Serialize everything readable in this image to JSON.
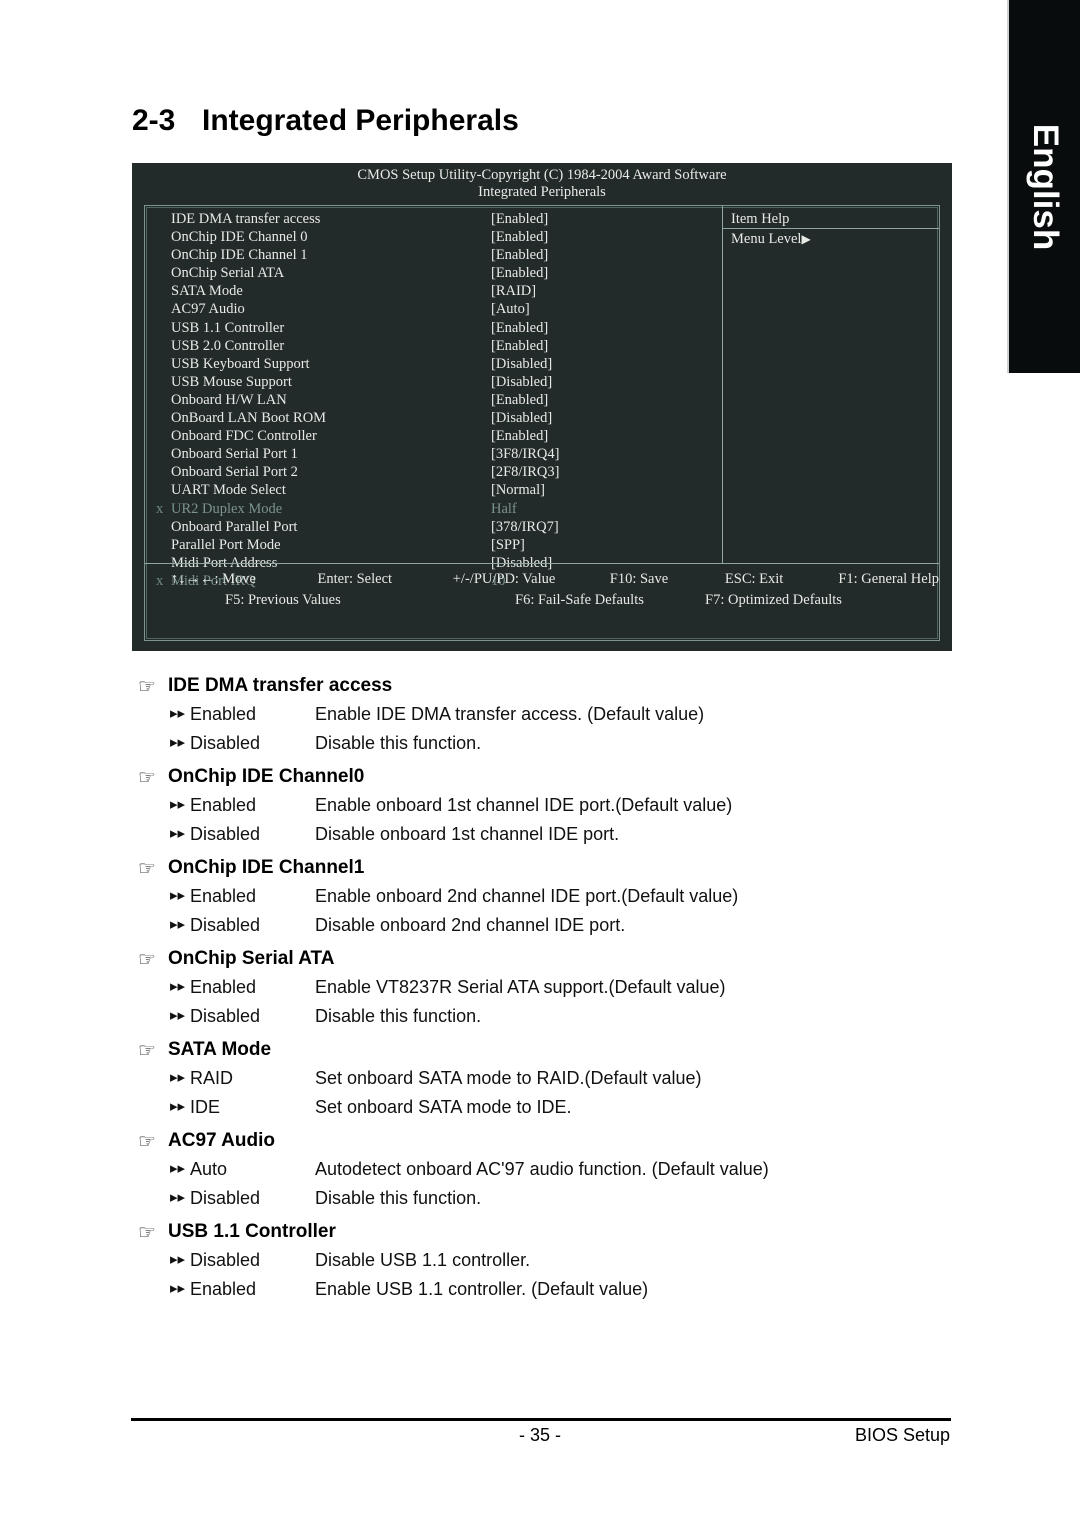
{
  "language_tab": {
    "label": "English"
  },
  "section": {
    "number": "2-3",
    "title": "Integrated Peripherals"
  },
  "bios": {
    "title_line1": "CMOS Setup Utility-Copyright (C) 1984-2004 Award Software",
    "title_line2": "Integrated Peripherals",
    "items": [
      {
        "marker": "",
        "label": "IDE DMA transfer access",
        "value": "[Enabled]",
        "dim": false
      },
      {
        "marker": "",
        "label": "OnChip IDE Channel 0",
        "value": "[Enabled]",
        "dim": false
      },
      {
        "marker": "",
        "label": "OnChip IDE Channel 1",
        "value": "[Enabled]",
        "dim": false
      },
      {
        "marker": "",
        "label": "OnChip Serial ATA",
        "value": "[Enabled]",
        "dim": false
      },
      {
        "marker": "",
        "label": "SATA Mode",
        "value": "[RAID]",
        "dim": false
      },
      {
        "marker": "",
        "label": "AC97 Audio",
        "value": "[Auto]",
        "dim": false
      },
      {
        "marker": "",
        "label": "USB 1.1 Controller",
        "value": "[Enabled]",
        "dim": false
      },
      {
        "marker": "",
        "label": "USB 2.0 Controller",
        "value": "[Enabled]",
        "dim": false
      },
      {
        "marker": "",
        "label": "USB Keyboard Support",
        "value": "[Disabled]",
        "dim": false
      },
      {
        "marker": "",
        "label": "USB Mouse Support",
        "value": "[Disabled]",
        "dim": false
      },
      {
        "marker": "",
        "label": "Onboard H/W LAN",
        "value": "[Enabled]",
        "dim": false
      },
      {
        "marker": "",
        "label": "OnBoard LAN Boot ROM",
        "value": "[Disabled]",
        "dim": false
      },
      {
        "marker": "",
        "label": "Onboard FDC Controller",
        "value": "[Enabled]",
        "dim": false
      },
      {
        "marker": "",
        "label": "Onboard Serial Port 1",
        "value": "[3F8/IRQ4]",
        "dim": false
      },
      {
        "marker": "",
        "label": "Onboard Serial Port 2",
        "value": "[2F8/IRQ3]",
        "dim": false
      },
      {
        "marker": "",
        "label": "UART Mode Select",
        "value": "[Normal]",
        "dim": false
      },
      {
        "marker": "x",
        "label": "UR2 Duplex Mode",
        "value": "Half",
        "dim": true
      },
      {
        "marker": "",
        "label": "Onboard Parallel Port",
        "value": "[378/IRQ7]",
        "dim": false
      },
      {
        "marker": "",
        "label": "Parallel Port Mode",
        "value": "[SPP]",
        "dim": false
      },
      {
        "marker": "",
        "label": "Midi Port Address",
        "value": "[Disabled]",
        "dim": false
      },
      {
        "marker": "x",
        "label": "Midi Port IRQ",
        "value": "10",
        "dim": true
      }
    ],
    "help": {
      "heading": "Item Help",
      "menu_level": "Menu Level",
      "menu_level_arrow": "▶"
    },
    "keys_row1": [
      "↑↓→←: Move",
      "Enter: Select",
      "+/-/PU/PD: Value",
      "F10: Save",
      "ESC: Exit",
      "F1: General Help"
    ],
    "keys_row2": [
      "F5: Previous Values",
      "F6: Fail-Safe Defaults",
      "F7: Optimized Defaults"
    ]
  },
  "options": [
    {
      "title": "IDE DMA transfer access",
      "rows": [
        {
          "name": "Enabled",
          "desc": "Enable IDE DMA transfer access. (Default value)"
        },
        {
          "name": "Disabled",
          "desc": "Disable this function."
        }
      ]
    },
    {
      "title": "OnChip IDE Channel0",
      "rows": [
        {
          "name": "Enabled",
          "desc": "Enable onboard 1st channel IDE port.(Default value)"
        },
        {
          "name": "Disabled",
          "desc": "Disable onboard 1st channel IDE port."
        }
      ]
    },
    {
      "title": "OnChip IDE Channel1",
      "rows": [
        {
          "name": "Enabled",
          "desc": "Enable onboard 2nd channel IDE port.(Default value)"
        },
        {
          "name": "Disabled",
          "desc": "Disable onboard 2nd channel IDE port."
        }
      ]
    },
    {
      "title": "OnChip Serial ATA",
      "rows": [
        {
          "name": "Enabled",
          "desc": "Enable VT8237R Serial ATA support.(Default value)"
        },
        {
          "name": "Disabled",
          "desc": "Disable this function."
        }
      ]
    },
    {
      "title": "SATA Mode",
      "rows": [
        {
          "name": "RAID",
          "desc": "Set onboard SATA mode to RAID.(Default value)"
        },
        {
          "name": "IDE",
          "desc": "Set onboard SATA mode to IDE."
        }
      ]
    },
    {
      "title": "AC97 Audio",
      "rows": [
        {
          "name": "Auto",
          "desc": "Autodetect onboard AC'97 audio function. (Default value)"
        },
        {
          "name": "Disabled",
          "desc": "Disable this function."
        }
      ]
    },
    {
      "title": "USB 1.1 Controller",
      "rows": [
        {
          "name": "Disabled",
          "desc": "Disable USB 1.1 controller."
        },
        {
          "name": "Enabled",
          "desc": "Enable USB 1.1 controller. (Default value)"
        }
      ]
    }
  ],
  "footer": {
    "page_number": "- 35 -",
    "right_label": "BIOS Setup"
  },
  "glyphs": {
    "hand": "☞",
    "bullet_arrow": "▸▸"
  },
  "colors": {
    "bios_background": "#232a2a",
    "bios_text": "#e8eae6",
    "bios_dim_text": "#7b938f",
    "bios_border": "#8fa7a3",
    "tab_background": "#080c0c"
  }
}
